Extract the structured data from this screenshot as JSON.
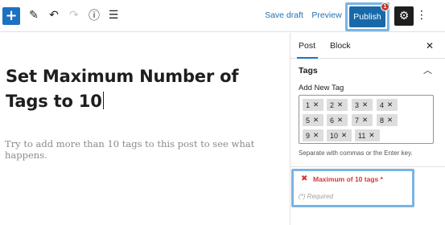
{
  "toolbar": {
    "inserter_icon": "+",
    "tools_icon": "✎",
    "undo_icon": "↶",
    "redo_icon": "↷",
    "details_icon": "ⓘ",
    "outline_icon": "☰",
    "save_draft_label": "Save draft",
    "preview_label": "Preview",
    "publish_label": "Publish",
    "publish_badge": "1",
    "settings_icon": "⚙",
    "more_icon": "⋮"
  },
  "editor": {
    "title": "Set Maximum Number of Tags to 10",
    "paragraph": "Try to add more than 10 tags to this post to see what happens."
  },
  "sidebar": {
    "tabs": [
      "Post",
      "Block"
    ],
    "close_icon": "✕",
    "panel": {
      "title": "Tags",
      "toggle_icon": "︿",
      "add_label": "Add New Tag",
      "tags": [
        "1",
        "2",
        "3",
        "4",
        "5",
        "6",
        "7",
        "8",
        "9",
        "10",
        "11"
      ],
      "remove_icon": "✕",
      "help": "Separate with commas or the Enter key."
    },
    "limit": {
      "icon": "✖",
      "message": "Maximum of 10 tags *",
      "required": "(*) Required"
    }
  },
  "colors": {
    "accent": "#1e70c1",
    "error": "#d63638",
    "highlight": "#7ab4e4"
  }
}
